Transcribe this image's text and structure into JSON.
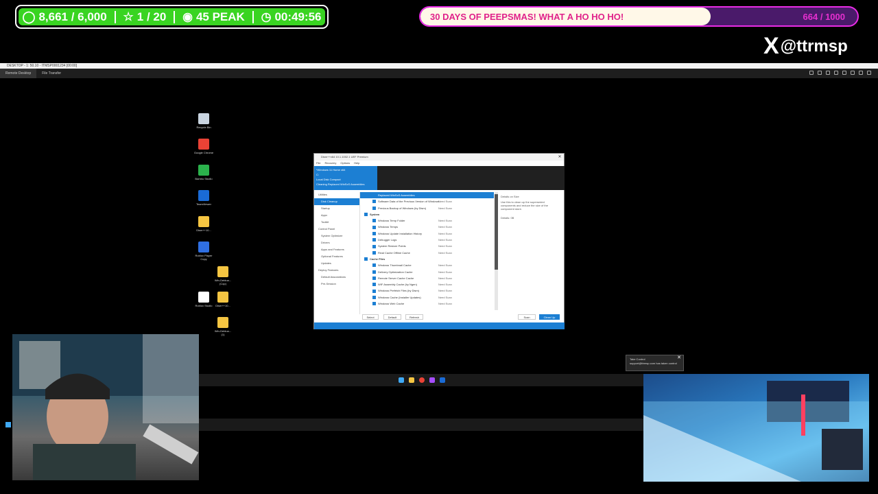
{
  "stream": {
    "followers": "8,661 / 6,000",
    "subs": "1 / 20",
    "peak": "45 PEAK",
    "uptime": "00:49:56",
    "goal_title": "30 DAYS OF PEEPSMAS! WHAT A HO HO HO!",
    "goal_count": "664 / 1000",
    "goal_progress": 0.664,
    "handle": "@ttrmsp"
  },
  "remote": {
    "title": "DESKTOP - 1: 50.10 - ITMSP0001234 [00:00]",
    "tabs": [
      "Remote Desktop",
      "File Transfer"
    ]
  },
  "desktop_icons": [
    {
      "label": "Recycle Bin",
      "icon": "recycle-bin-icon",
      "color": "#c9d4e0"
    },
    {
      "label": "Google Chrome",
      "icon": "chrome-icon",
      "color": "#e94235"
    },
    {
      "label": "Bambu Studio",
      "icon": "bambu-studio-icon",
      "color": "#2bb24c"
    },
    {
      "label": "TeamViewer",
      "icon": "teamviewer-icon",
      "color": "#1a6bd6"
    },
    {
      "label": "Dism++10...",
      "icon": "folder-icon",
      "color": "#f5c542"
    },
    {
      "label": "Roblox Player Copy",
      "icon": "roblox-icon",
      "color": "#2f6fe3"
    },
    {
      "label": "Win-Debloa... (Cop)",
      "icon": "folder-icon",
      "color": "#f5c542"
    },
    {
      "label": "Roblox Studio",
      "icon": "roblox-studio-icon",
      "color": "#ffffff"
    },
    {
      "label": "Dism++10...",
      "icon": "folder-icon",
      "color": "#f5c542"
    },
    {
      "label": "Win-Debloa... (1)",
      "icon": "folder-icon",
      "color": "#f5c542"
    }
  ],
  "app": {
    "title": "Dism++x64 10.1.1002.1 UEF Premium",
    "menu": [
      "File",
      "Recovery",
      "Options",
      "Help"
    ],
    "header_lines": [
      "*Windows 11 Home x64",
      "C:",
      "Local Disk Compact",
      "Cleaning Replaced WinSxS Assemblies"
    ],
    "nav": [
      {
        "label": "Utilities",
        "sel": false,
        "sub": false
      },
      {
        "label": "Disk Cleanup",
        "sel": true,
        "sub": true
      },
      {
        "label": "Startup",
        "sel": false,
        "sub": true
      },
      {
        "label": "Appx",
        "sel": false,
        "sub": true
      },
      {
        "label": "Toolkit",
        "sel": false,
        "sub": true
      },
      {
        "label": "Control Panel",
        "sel": false,
        "sub": false
      },
      {
        "label": "System Optimizer",
        "sel": false,
        "sub": true
      },
      {
        "label": "Drivers",
        "sel": false,
        "sub": true
      },
      {
        "label": "Apps and Features",
        "sel": false,
        "sub": true
      },
      {
        "label": "Optional Features",
        "sel": false,
        "sub": true
      },
      {
        "label": "Updates",
        "sel": false,
        "sub": true
      },
      {
        "label": "Deploy Features",
        "sel": false,
        "sub": false
      },
      {
        "label": "Default Associations",
        "sel": false,
        "sub": true
      },
      {
        "label": "Pre-Session",
        "sel": false,
        "sub": true
      }
    ],
    "rows": [
      {
        "label": "Replaced WinSxS Assemblies",
        "status": "",
        "sel": true,
        "group": false
      },
      {
        "label": "Software Data of the Previous Version of Windows",
        "status": "Need Scan",
        "sel": false,
        "group": false
      },
      {
        "label": "Previous Backup of Windows (by Dism)",
        "status": "Need Scan",
        "sel": false,
        "group": false
      },
      {
        "label": "System",
        "status": "",
        "sel": false,
        "group": true
      },
      {
        "label": "Windows Temp Folder",
        "status": "Need Scan",
        "sel": false,
        "group": false
      },
      {
        "label": "Windows Temps",
        "status": "Need Scan",
        "sel": false,
        "group": false
      },
      {
        "label": "Windows Update Installation History",
        "status": "Need Scan",
        "sel": false,
        "group": false
      },
      {
        "label": "Debugger Logs",
        "status": "Need Scan",
        "sel": false,
        "group": false
      },
      {
        "label": "System Restore Points",
        "status": "Need Scan",
        "sel": false,
        "group": false
      },
      {
        "label": "Rival Cache Offline Cache",
        "status": "Need Scan",
        "sel": false,
        "group": false
      },
      {
        "label": "Cache Files",
        "status": "",
        "sel": false,
        "group": true
      },
      {
        "label": "Windows Thumbnail Cache",
        "status": "Need Scan",
        "sel": false,
        "group": false
      },
      {
        "label": "Delivery Optimization Cache",
        "status": "Need Scan",
        "sel": false,
        "group": false
      },
      {
        "label": "Remote Server Cache Cache",
        "status": "Need Scan",
        "sel": false,
        "group": false
      },
      {
        "label": "WIF Assembly Cache (by Ngen)",
        "status": "Need Scan",
        "sel": false,
        "group": false
      },
      {
        "label": "Windows Prefetch Files (by Dism)",
        "status": "Need Scan",
        "sel": false,
        "group": false
      },
      {
        "label": "Windows Cache (Installer Updates)",
        "status": "Need Scan",
        "sel": false,
        "group": false
      },
      {
        "label": "Windows Web Cache",
        "status": "Need Scan",
        "sel": false,
        "group": false
      }
    ],
    "desc_title": "Details on Size",
    "desc_text": "Use this to clean up the superseded components and reduce the size of the component store.",
    "desc_size": "Details: 0B",
    "buttons": {
      "select": "Select",
      "default": "Default",
      "refresh": "Refresh",
      "scan": "Scan",
      "cleanup": "Clean Up"
    }
  },
  "toast": {
    "title": "Take Control",
    "text": "support@ttrmsp.com has taken control"
  }
}
